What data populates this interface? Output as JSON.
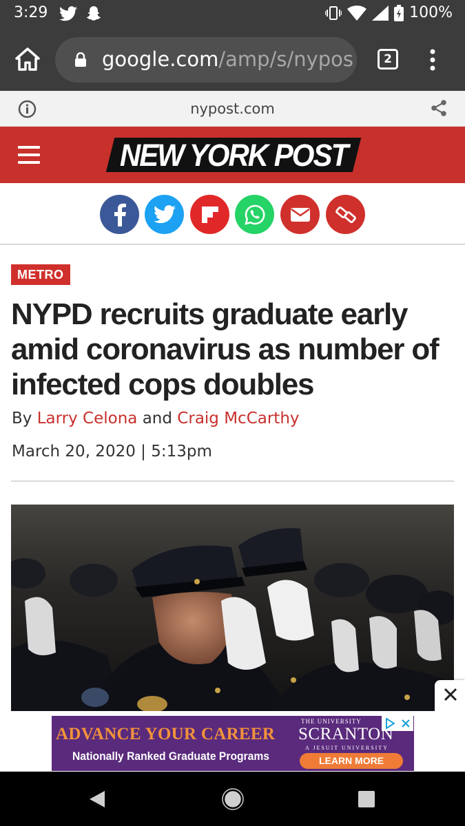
{
  "status_bar": {
    "time": "3:29",
    "battery": "100%",
    "left_icons": [
      "twitter-icon",
      "snapchat-icon"
    ],
    "right_icons": [
      "vibrate-icon",
      "wifi-icon",
      "signal-icon",
      "battery-icon"
    ]
  },
  "browser": {
    "url_host": "google.com",
    "url_path": "/amp/s/nypos",
    "tab_count": "2"
  },
  "amp_bar": {
    "domain": "nypost.com"
  },
  "header": {
    "logo": "NEW YORK POST"
  },
  "share": {
    "buttons": [
      {
        "name": "facebook",
        "color": "#3b5998"
      },
      {
        "name": "twitter",
        "color": "#1da1f2"
      },
      {
        "name": "flipboard",
        "color": "#e12828"
      },
      {
        "name": "whatsapp",
        "color": "#25d366"
      },
      {
        "name": "email",
        "color": "#d0302c"
      },
      {
        "name": "copy-link",
        "color": "#d0302c"
      }
    ]
  },
  "article": {
    "category": "METRO",
    "headline": "NYPD recruits graduate early amid coronavirus as number of infected cops doubles",
    "byline_prefix": "By",
    "author_1": "Larry Celona",
    "byline_and": "and",
    "author_2": "Craig McCarthy",
    "date": "March 20, 2020 | 5:13pm"
  },
  "ad": {
    "headline": "ADVANCE YOUR CAREER",
    "subline": "Nationally Ranked Graduate Programs",
    "university_label": "THE UNIVERSITY",
    "university_name": "SCRANTON",
    "university_tag": "A JESUIT UNIVERSITY",
    "cta": "LEARN MORE"
  },
  "colors": {
    "brand_red": "#c8302c",
    "chrome_dark": "#3c3c3c",
    "ad_purple": "#5a2a7c",
    "ad_orange": "#ef7b37"
  }
}
